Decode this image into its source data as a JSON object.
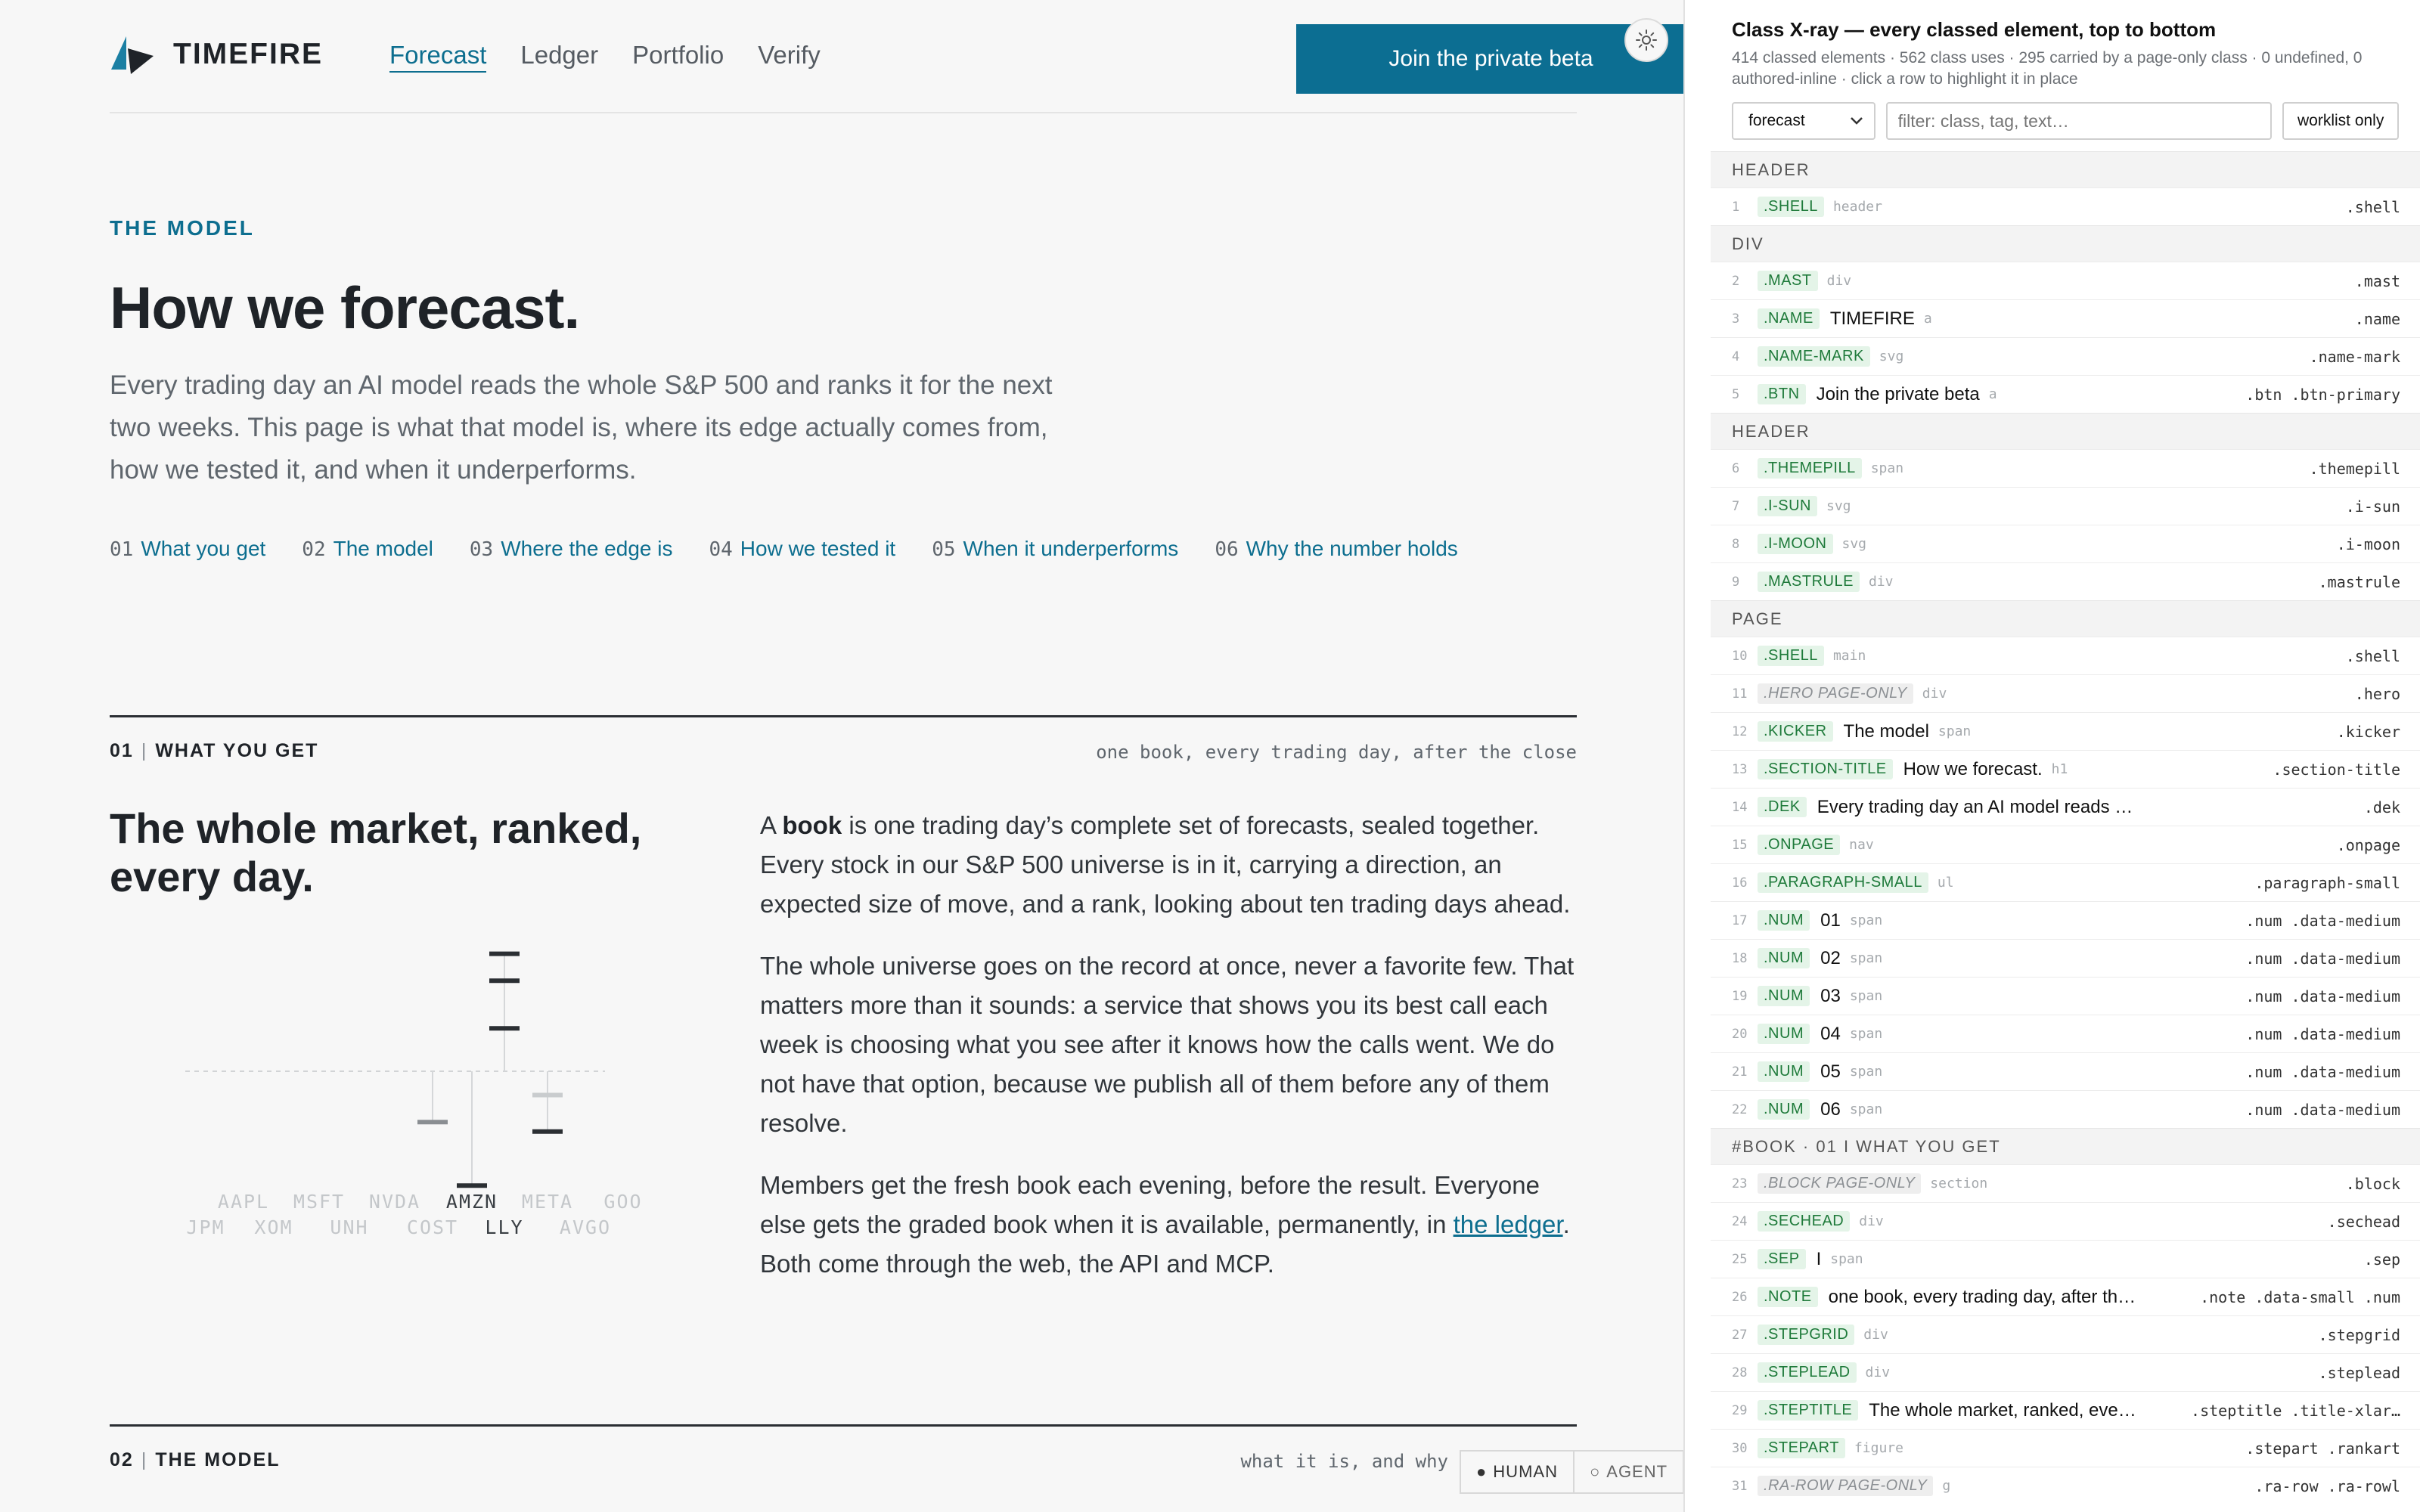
{
  "header": {
    "brand": "TIMEFIRE",
    "nav": [
      {
        "label": "Forecast",
        "active": true
      },
      {
        "label": "Ledger",
        "active": false
      },
      {
        "label": "Portfolio",
        "active": false
      },
      {
        "label": "Verify",
        "active": false
      }
    ],
    "cta": "Join the private beta",
    "theme_icon": "sun-icon"
  },
  "hero": {
    "kicker": "THE MODEL",
    "title": "How we forecast.",
    "dek": "Every trading day an AI model reads the whole S&P 500 and ranks it for the next two weeks. This page is what that model is, where its edge actually comes from, how we tested it, and when it underperforms.",
    "onpage": [
      {
        "num": "01",
        "label": "What you get"
      },
      {
        "num": "02",
        "label": "The model"
      },
      {
        "num": "03",
        "label": "Where the edge is"
      },
      {
        "num": "04",
        "label": "How we tested it"
      },
      {
        "num": "05",
        "label": "When it underperforms"
      },
      {
        "num": "06",
        "label": "Why the number holds"
      }
    ]
  },
  "section1": {
    "num": "01",
    "sep": "|",
    "label": "WHAT YOU GET",
    "note": "one book, every trading day, after the close",
    "title": "The whole market, ranked, every day.",
    "p1_pre": "A ",
    "p1_bold": "book",
    "p1_post": " is one trading day’s complete set of forecasts, sealed together. Every stock in our S&P 500 universe is in it, carrying a direction, an expected size of move, and a rank, looking about ten trading days ahead.",
    "p2": "The whole universe goes on the record at once, never a favorite few. That matters more than it sounds: a service that shows you its best call each week is choosing what you see after it knows how the calls went. We do not have that option, because we publish all of them before any of them resolve.",
    "p3_pre": "Members get the fresh book each evening, before the result. Everyone else gets the graded book when it is available, permanently, in ",
    "p3_link": "the ledger",
    "p3_post": ". Both come through the web, the API and MCP."
  },
  "section2": {
    "num": "02",
    "sep": "|",
    "label": "THE MODEL",
    "note": "what it is, and why"
  },
  "audience": {
    "human": "HUMAN",
    "agent": "AGENT"
  },
  "chart_data": {
    "type": "scatter",
    "categories_row1": [
      "AAPL",
      "MSFT",
      "NVDA",
      "AMZN",
      "META",
      "GOO"
    ],
    "categories_row2": [
      "JPM",
      "XOM",
      "UNH",
      "COST",
      "LLY",
      "AVGO"
    ],
    "highlighted": [
      "AMZN",
      "LLY"
    ],
    "marks": [
      {
        "ticker": "LLY",
        "value": 0.74,
        "color": "#2b2f33"
      },
      {
        "ticker": "LLY",
        "value": 0.57,
        "color": "#2b2f33"
      },
      {
        "ticker": "LLY",
        "value": 0.27,
        "color": "#2b2f33"
      },
      {
        "ticker": "COST",
        "value": -0.32,
        "color": "#8a8e92"
      },
      {
        "ticker": "META",
        "value": -0.15,
        "color": "#c9ccce"
      },
      {
        "ticker": "META",
        "value": -0.38,
        "color": "#2b2f33"
      },
      {
        "ticker": "AMZN",
        "value": -0.72,
        "color": "#2b2f33"
      }
    ],
    "ylim": [
      -1,
      1
    ],
    "baseline": 0
  },
  "xray": {
    "title": "Class X-ray — every classed element, top to bottom",
    "subtitle": "414 classed elements · 562 class uses · 295 carried by a page-only class · 0 undefined, 0 authored-inline · click a row to highlight it in place",
    "select_value": "forecast",
    "filter_placeholder": "filter: class, tag, text…",
    "worklist_label": "worklist only",
    "rows": [
      {
        "type": "group",
        "label": "HEADER"
      },
      {
        "n": "1",
        "cls": ".SHELL",
        "tag": "header",
        "sel": ".shell"
      },
      {
        "type": "group",
        "label": "DIV"
      },
      {
        "n": "2",
        "cls": ".MAST",
        "tag": "div",
        "sel": ".mast"
      },
      {
        "n": "3",
        "cls": ".NAME",
        "txt": "TIMEFIRE",
        "tag": "a",
        "sel": ".name"
      },
      {
        "n": "4",
        "cls": ".NAME-MARK",
        "tag": "svg",
        "sel": ".name-mark"
      },
      {
        "n": "5",
        "cls": ".BTN",
        "txt": "Join the private beta",
        "tag": "a",
        "sel": ".btn .btn-primary"
      },
      {
        "type": "group",
        "label": "HEADER"
      },
      {
        "n": "6",
        "cls": ".THEMEPILL",
        "tag": "span",
        "sel": ".themepill"
      },
      {
        "n": "7",
        "cls": ".I-SUN",
        "tag": "svg",
        "sel": ".i-sun"
      },
      {
        "n": "8",
        "cls": ".I-MOON",
        "tag": "svg",
        "sel": ".i-moon"
      },
      {
        "n": "9",
        "cls": ".MASTRULE",
        "tag": "div",
        "sel": ".mastrule"
      },
      {
        "type": "group",
        "label": "PAGE"
      },
      {
        "n": "10",
        "cls": ".SHELL",
        "tag": "main",
        "sel": ".shell"
      },
      {
        "n": "11",
        "cls": ".HERO PAGE-ONLY",
        "po": true,
        "tag": "div",
        "sel": ".hero"
      },
      {
        "n": "12",
        "cls": ".KICKER",
        "txt": "The model",
        "tag": "span",
        "sel": ".kicker"
      },
      {
        "n": "13",
        "cls": ".SECTION-TITLE",
        "txt": "How we forecast.",
        "tag": "h1",
        "sel": ".section-title"
      },
      {
        "n": "14",
        "cls": ".DEK",
        "txt": "Every trading day an AI model reads t…",
        "tag": "",
        "sel": ".dek"
      },
      {
        "n": "15",
        "cls": ".ONPAGE",
        "tag": "nav",
        "sel": ".onpage"
      },
      {
        "n": "16",
        "cls": ".PARAGRAPH-SMALL",
        "tag": "ul",
        "sel": ".paragraph-small"
      },
      {
        "n": "17",
        "cls": ".NUM",
        "txt": "01",
        "tag": "span",
        "sel": ".num .data-medium"
      },
      {
        "n": "18",
        "cls": ".NUM",
        "txt": "02",
        "tag": "span",
        "sel": ".num .data-medium"
      },
      {
        "n": "19",
        "cls": ".NUM",
        "txt": "03",
        "tag": "span",
        "sel": ".num .data-medium"
      },
      {
        "n": "20",
        "cls": ".NUM",
        "txt": "04",
        "tag": "span",
        "sel": ".num .data-medium"
      },
      {
        "n": "21",
        "cls": ".NUM",
        "txt": "05",
        "tag": "span",
        "sel": ".num .data-medium"
      },
      {
        "n": "22",
        "cls": ".NUM",
        "txt": "06",
        "tag": "span",
        "sel": ".num .data-medium"
      },
      {
        "type": "group",
        "label": "#BOOK · 01 I WHAT YOU GET"
      },
      {
        "n": "23",
        "cls": ".BLOCK PAGE-ONLY",
        "po": true,
        "tag": "section",
        "sel": ".block"
      },
      {
        "n": "24",
        "cls": ".SECHEAD",
        "tag": "div",
        "sel": ".sechead"
      },
      {
        "n": "25",
        "cls": ".SEP",
        "txt": "I",
        "tag": "span",
        "sel": ".sep"
      },
      {
        "n": "26",
        "cls": ".NOTE",
        "txt": "one book, every trading day, after th…",
        "tag": "",
        "sel": ".note .data-small .num"
      },
      {
        "n": "27",
        "cls": ".STEPGRID",
        "tag": "div",
        "sel": ".stepgrid"
      },
      {
        "n": "28",
        "cls": ".STEPLEAD",
        "tag": "div",
        "sel": ".steplead"
      },
      {
        "n": "29",
        "cls": ".STEPTITLE",
        "txt": "The whole market, ranked, eve…",
        "tag": "",
        "sel": ".steptitle .title-xlar…"
      },
      {
        "n": "30",
        "cls": ".STEPART",
        "tag": "figure",
        "sel": ".stepart .rankart"
      },
      {
        "n": "31",
        "cls": ".RA-ROW PAGE-ONLY",
        "po": true,
        "tag": "g",
        "sel": ".ra-row .ra-rowl"
      }
    ]
  }
}
